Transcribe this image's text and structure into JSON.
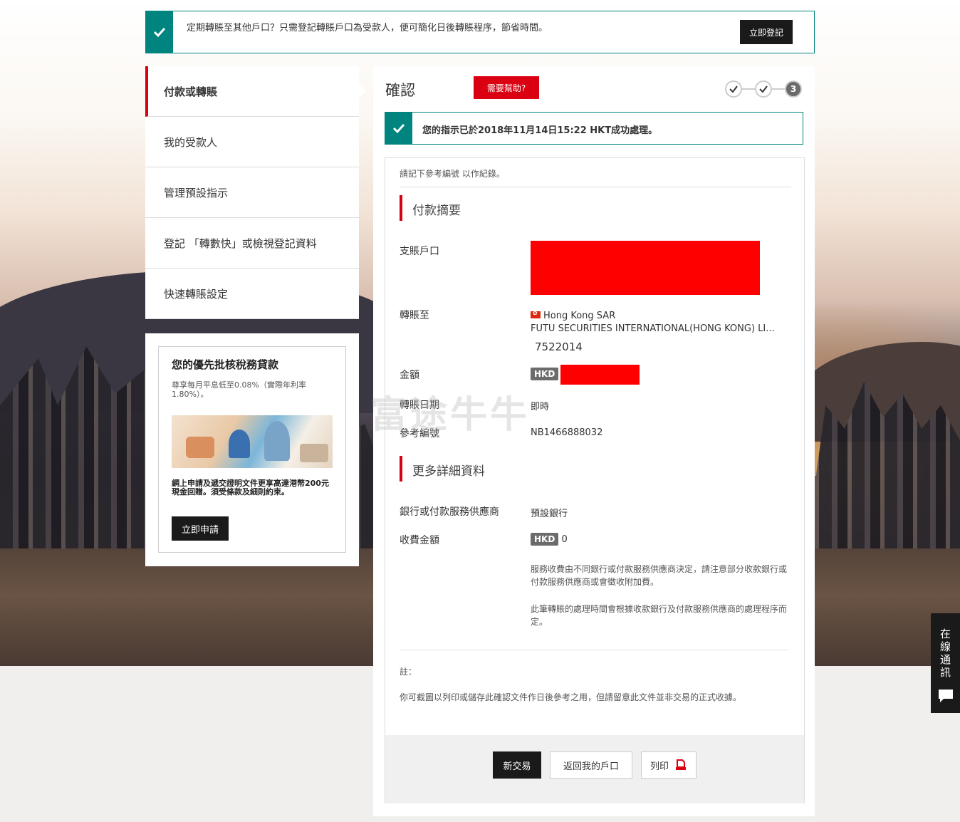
{
  "notice": {
    "text": "定期轉賬至其他戶口？只需登記轉賬戶口為受款人，便可簡化日後轉賬程序，節省時間。",
    "button": "立即登記"
  },
  "sidebar": {
    "items": [
      {
        "label": "付款或轉賬"
      },
      {
        "label": "我的受款人"
      },
      {
        "label": "管理預設指示"
      },
      {
        "label": "登記 「轉數快」或檢視登記資料"
      },
      {
        "label": "快速轉賬設定"
      }
    ]
  },
  "promo": {
    "title": "您的優先批核稅務貸款",
    "subtitle": "尊享每月平息低至0.08%（實際年利率1.80%）。",
    "description": "網上申請及遞交證明文件更享高達港幣200元現金回贈。須受條款及細則約束。",
    "button": "立即申請"
  },
  "main": {
    "title": "確認",
    "help": "需要幫助?",
    "steps": {
      "current": "3"
    },
    "success": "您的指示已於2018年11月14日15:22 HKT成功處理。",
    "note_top": "請記下參考編號 以作紀錄。",
    "summary_title": "付款摘要",
    "from_label": "支賬戶口",
    "to_label": "轉賬至",
    "to_region": "Hong Kong SAR",
    "to_bank": "FUTU SECURITIES INTERNATIONAL(HONG KONG) LI...",
    "to_account": "7522014",
    "amount_label": "金額",
    "currency": "HKD",
    "date_label": "轉賬日期",
    "date_value": "即時",
    "ref_label": "參考編號",
    "ref_value": "NB1466888032",
    "more_title": "更多詳細資料",
    "provider_label": "銀行或付款服務供應商",
    "provider_value": "預設銀行",
    "fee_label": "收費金額",
    "fee_currency": "HKD",
    "fee_value": "0",
    "fee_note1": "服務收費由不同銀行或付款服務供應商決定，請注意部分收款銀行或付款服務供應商或會徵收附加費。",
    "fee_note2": "此筆轉賬的處理時間會根據收款銀行及付款服務供應商的處理程序而定。",
    "remark_label": "註：",
    "remark_text": "你可截圖以列印或儲存此確認文件作日後參考之用，但請留意此文件並非交易的正式收據。",
    "btn_new": "新交易",
    "btn_back": "返回我的戶口",
    "btn_print": "列印"
  },
  "watermark": "富途牛牛",
  "chat": {
    "label": "在線通訊"
  },
  "colors": {
    "brand_red": "#db0011",
    "teal": "#00847f",
    "dark": "#1a1a1a"
  }
}
